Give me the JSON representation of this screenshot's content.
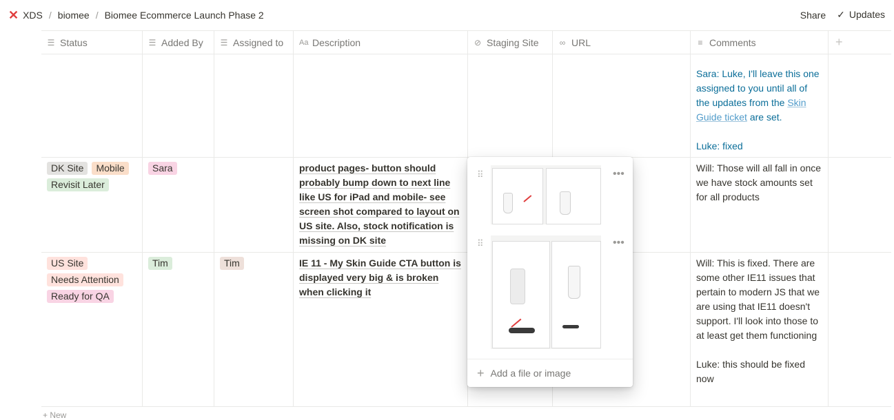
{
  "breadcrumb": {
    "workspace": "XDS",
    "parent": "biomee",
    "page": "Biomee Ecommerce Launch Phase 2"
  },
  "topbar": {
    "share": "Share",
    "updates": "Updates"
  },
  "columns": [
    {
      "label": "Status",
      "icon": "list-icon"
    },
    {
      "label": "Added By",
      "icon": "list-icon"
    },
    {
      "label": "Assigned to",
      "icon": "list-icon"
    },
    {
      "label": "Description",
      "icon": "text-icon"
    },
    {
      "label": "Staging Site",
      "icon": "attachment-icon"
    },
    {
      "label": "URL",
      "icon": "link-icon"
    },
    {
      "label": "Comments",
      "icon": "lines-icon"
    }
  ],
  "rows": [
    {
      "comments": {
        "part1": "Sara: Luke, I'll leave this one assigned to you until all of the updates from the ",
        "link": "Skin Guide ticket",
        "part2": " are set.",
        "line2": "Luke: fixed"
      }
    },
    {
      "status": [
        "DK Site",
        "Mobile",
        "Revisit Later"
      ],
      "added_by": "Sara",
      "description": "product pages- button should probably bump down to next line like US for iPad and mobile- see screen shot compared to layout on US site. Also, stock notification is missing on DK site",
      "comments": "Will: Those will all fall in once we have stock amounts set for all products"
    },
    {
      "status": [
        "US Site",
        "Needs Attention",
        "Ready for QA"
      ],
      "added_by": "Tim",
      "assigned_to": "Tim",
      "description": "IE 11 - My Skin Guide CTA button is displayed very big & is broken when clicking it",
      "comments": "Will: This is fixed. There are some other IE11 issues that pertain to modern JS that we are using that IE11 doesn't support. I'll look into those to at least get them functioning",
      "comments2": "Luke: this should be fixed now"
    }
  ],
  "popup": {
    "add_label": "Add a file or image"
  },
  "colors": {
    "accent_blue": "#0b6e99",
    "link": "#529cca",
    "logo_red": "#e03e3e"
  }
}
